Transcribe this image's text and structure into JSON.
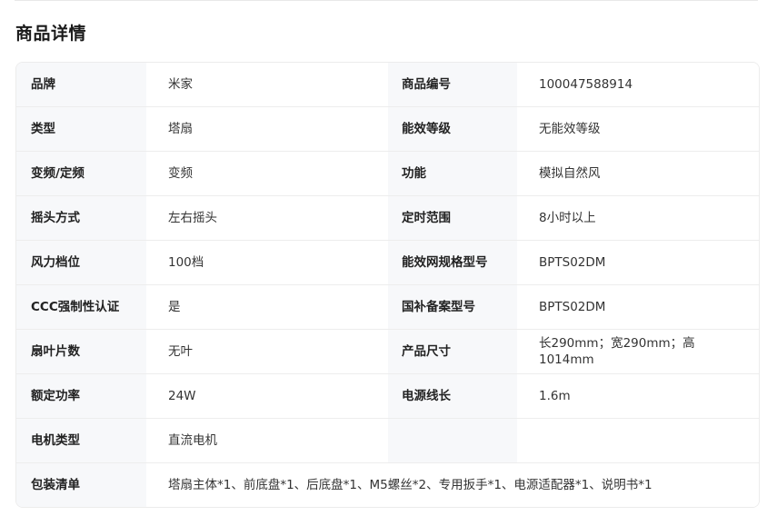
{
  "section_title": "商品详情",
  "specs": [
    {
      "l1": "品牌",
      "v1": "米家",
      "l2": "商品编号",
      "v2": "100047588914"
    },
    {
      "l1": "类型",
      "v1": "塔扇",
      "l2": "能效等级",
      "v2": "无能效等级"
    },
    {
      "l1": "变频/定频",
      "v1": "变频",
      "l2": "功能",
      "v2": "模拟自然风"
    },
    {
      "l1": "摇头方式",
      "v1": "左右摇头",
      "l2": "定时范围",
      "v2": "8小时以上"
    },
    {
      "l1": "风力档位",
      "v1": "100档",
      "l2": "能效网规格型号",
      "v2": "BPTS02DM"
    },
    {
      "l1": "CCC强制性认证",
      "v1": "是",
      "l2": "国补备案型号",
      "v2": "BPTS02DM"
    },
    {
      "l1": "扇叶片数",
      "v1": "无叶",
      "l2": "产品尺寸",
      "v2": "长290mm；宽290mm；高1014mm"
    },
    {
      "l1": "额定功率",
      "v1": "24W",
      "l2": "电源线长",
      "v2": "1.6m"
    },
    {
      "l1": "电机类型",
      "v1": "直流电机",
      "l2": "",
      "v2": ""
    }
  ],
  "package": {
    "label": "包装清单",
    "value": "塔扇主体*1、前底盘*1、后底盘*1、M5螺丝*2、专用扳手*1、电源适配器*1、说明书*1"
  }
}
